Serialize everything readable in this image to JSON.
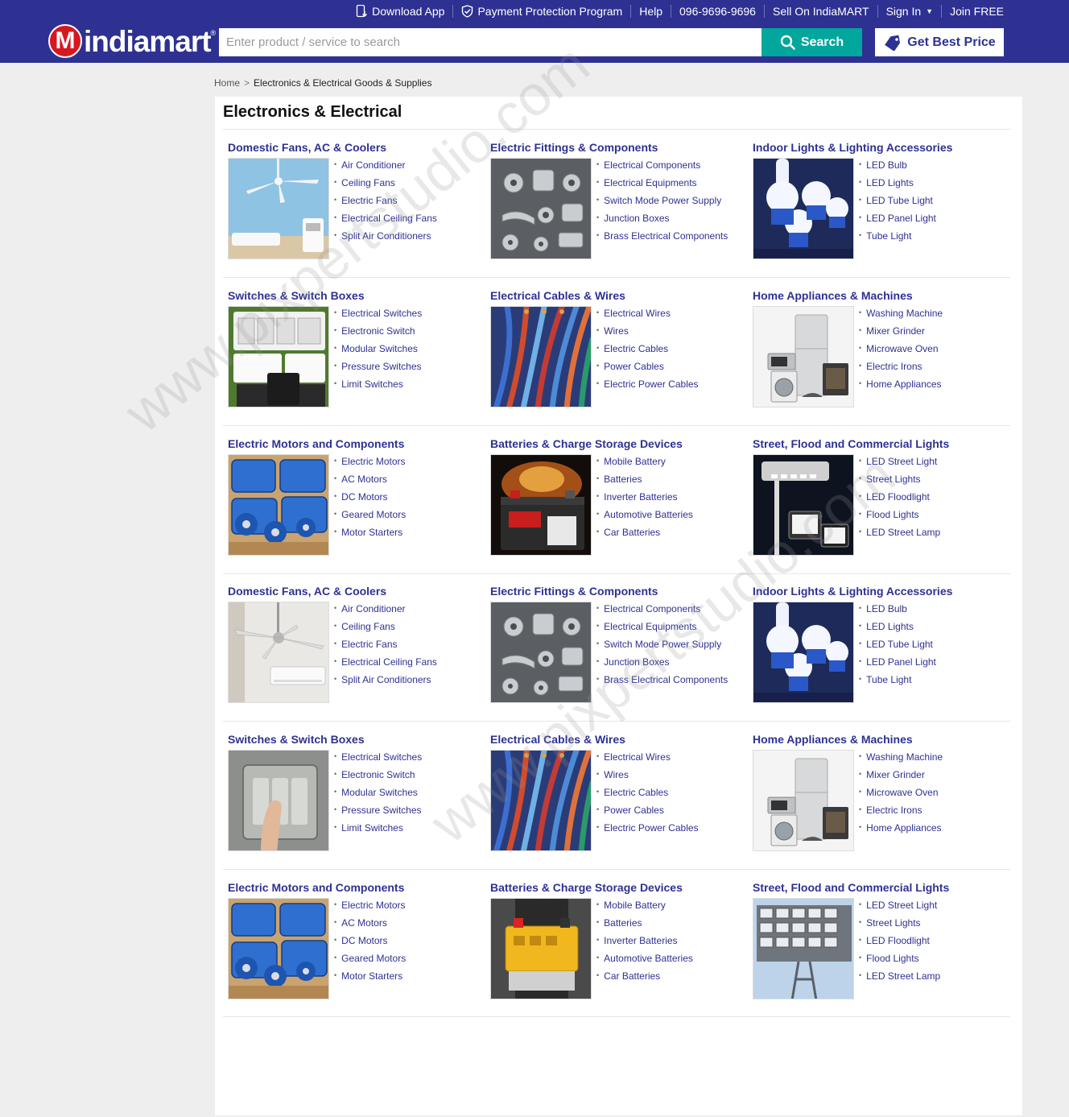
{
  "header": {
    "links": {
      "download_app": "Download App",
      "payment_protection": "Payment Protection Program",
      "help": "Help",
      "phone": "096-9696-9696",
      "sell": "Sell On IndiaMART",
      "sign_in": "Sign In",
      "join": "Join FREE"
    },
    "logo": {
      "letter": "M",
      "text": "indiamart",
      "reg": "®"
    },
    "search": {
      "placeholder": "Enter product / service to search",
      "button": "Search"
    },
    "best_price": "Get Best Price"
  },
  "breadcrumb": {
    "home": "Home",
    "separator": ">",
    "current": "Electronics & Electrical Goods & Supplies"
  },
  "page_title": "Electronics & Electrical",
  "categories": [
    {
      "title": "Domestic Fans, AC & Coolers",
      "image": "ceiling-fan-ac",
      "items": [
        "Air Conditioner",
        "Ceiling Fans",
        "Electric Fans",
        "Electrical Ceiling Fans",
        "Split Air Conditioners"
      ]
    },
    {
      "title": "Electric Fittings & Components",
      "image": "metal-fittings",
      "items": [
        "Electrical Components",
        "Electrical Equipments",
        "Switch Mode Power Supply",
        "Junction Boxes",
        "Brass Electrical Components"
      ]
    },
    {
      "title": "Indoor Lights & Lighting Accessories",
      "image": "led-bulbs",
      "items": [
        "LED Bulb",
        "LED Lights",
        "LED Tube Light",
        "LED Panel Light",
        "Tube Light"
      ]
    },
    {
      "title": "Switches & Switch Boxes",
      "image": "switch-panels",
      "items": [
        "Electrical Switches",
        "Electronic Switch",
        "Modular Switches",
        "Pressure Switches",
        "Limit Switches"
      ]
    },
    {
      "title": "Electrical Cables & Wires",
      "image": "colored-wires",
      "items": [
        "Electrical Wires",
        "Wires",
        "Electric Cables",
        "Power Cables",
        "Electric Power Cables"
      ]
    },
    {
      "title": "Home Appliances & Machines",
      "image": "home-appliances",
      "items": [
        "Washing Machine",
        "Mixer Grinder",
        "Microwave Oven",
        "Electric Irons",
        "Home Appliances"
      ]
    },
    {
      "title": "Electric Motors and Components",
      "image": "blue-motors",
      "items": [
        "Electric Motors",
        "AC Motors",
        "DC Motors",
        "Geared Motors",
        "Motor Starters"
      ]
    },
    {
      "title": "Batteries & Charge Storage Devices",
      "image": "car-battery",
      "items": [
        "Mobile Battery",
        "Batteries",
        "Inverter Batteries",
        "Automotive Batteries",
        "Car Batteries"
      ]
    },
    {
      "title": "Street, Flood and Commercial Lights",
      "image": "street-light",
      "items": [
        "LED Street Light",
        "Street Lights",
        "LED Floodlight",
        "Flood Lights",
        "LED Street Lamp"
      ]
    },
    {
      "title": "Domestic Fans, AC & Coolers",
      "image": "ceiling-fan-room",
      "items": [
        "Air Conditioner",
        "Ceiling Fans",
        "Electric Fans",
        "Electrical Ceiling Fans",
        "Split Air Conditioners"
      ]
    },
    {
      "title": "Electric Fittings & Components",
      "image": "metal-fittings",
      "items": [
        "Electrical Components",
        "Electrical Equipments",
        "Switch Mode Power Supply",
        "Junction Boxes",
        "Brass Electrical Components"
      ]
    },
    {
      "title": "Indoor Lights & Lighting Accessories",
      "image": "led-bulbs",
      "items": [
        "LED Bulb",
        "LED Lights",
        "LED Tube Light",
        "LED Panel Light",
        "Tube Light"
      ]
    },
    {
      "title": "Switches & Switch Boxes",
      "image": "light-switch",
      "items": [
        "Electrical Switches",
        "Electronic Switch",
        "Modular Switches",
        "Pressure Switches",
        "Limit Switches"
      ]
    },
    {
      "title": "Electrical Cables & Wires",
      "image": "colored-wires",
      "items": [
        "Electrical Wires",
        "Wires",
        "Electric Cables",
        "Power Cables",
        "Electric Power Cables"
      ]
    },
    {
      "title": "Home Appliances & Machines",
      "image": "home-appliances",
      "items": [
        "Washing Machine",
        "Mixer Grinder",
        "Microwave Oven",
        "Electric Irons",
        "Home Appliances"
      ]
    },
    {
      "title": "Electric Motors and Components",
      "image": "blue-motors",
      "items": [
        "Electric Motors",
        "AC Motors",
        "DC Motors",
        "Geared Motors",
        "Motor Starters"
      ]
    },
    {
      "title": "Batteries & Charge Storage Devices",
      "image": "yellow-battery",
      "items": [
        "Mobile Battery",
        "Batteries",
        "Inverter Batteries",
        "Automotive Batteries",
        "Car Batteries"
      ]
    },
    {
      "title": "Street, Flood and Commercial Lights",
      "image": "flood-tower",
      "items": [
        "LED Street Light",
        "Street Lights",
        "LED Floodlight",
        "Flood Lights",
        "LED Street Lamp"
      ]
    }
  ],
  "watermark": "www.pixpertstudio.com",
  "colors": {
    "header_bg": "#2e3192",
    "accent_teal": "#01a69c",
    "logo_red": "#d7171f",
    "link_blue": "#2e3192"
  }
}
